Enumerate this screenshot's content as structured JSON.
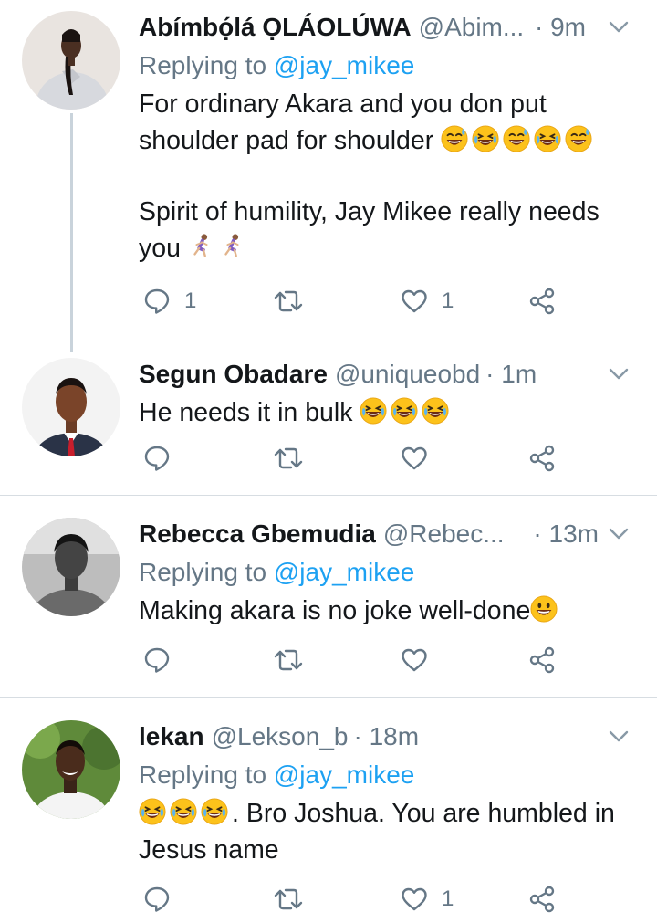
{
  "tweets": [
    {
      "name": "Abímbọ́lá ỌLÁOLÚWA",
      "handle": "@Abim...",
      "time": "· 9m",
      "replying_prefix": "Replying to ",
      "replying_to": "@jay_mikee",
      "text_1": "For ordinary Akara and you don put shoulder pad for shoulder",
      "text_2": "Spirit of humility, Jay Mikee really needs you",
      "reply_count": "1",
      "like_count": "1"
    },
    {
      "name": "Segun Obadare",
      "handle": "@uniqueobd",
      "time": "· 1m",
      "text_1": "He needs it in bulk"
    },
    {
      "name": "Rebecca Gbemudia",
      "handle": "@Rebec...",
      "time": "· 13m",
      "replying_prefix": "Replying to ",
      "replying_to": "@jay_mikee",
      "text_1": "Making akara is no joke well-done"
    },
    {
      "name": "lekan",
      "handle": "@Lekson_b",
      "time": "· 18m",
      "replying_prefix": "Replying to ",
      "replying_to": "@jay_mikee",
      "text_1": ". Bro Joshua. You are humbled in Jesus name",
      "like_count": "1"
    }
  ],
  "colors": {
    "link": "#1da1f2",
    "muted": "#657786",
    "separator": "#d7dde2"
  },
  "icons": [
    "reply-icon",
    "retweet-icon",
    "like-icon",
    "share-icon",
    "chevron-down-icon",
    "laughing-emoji",
    "running-emoji",
    "grinning-emoji"
  ]
}
